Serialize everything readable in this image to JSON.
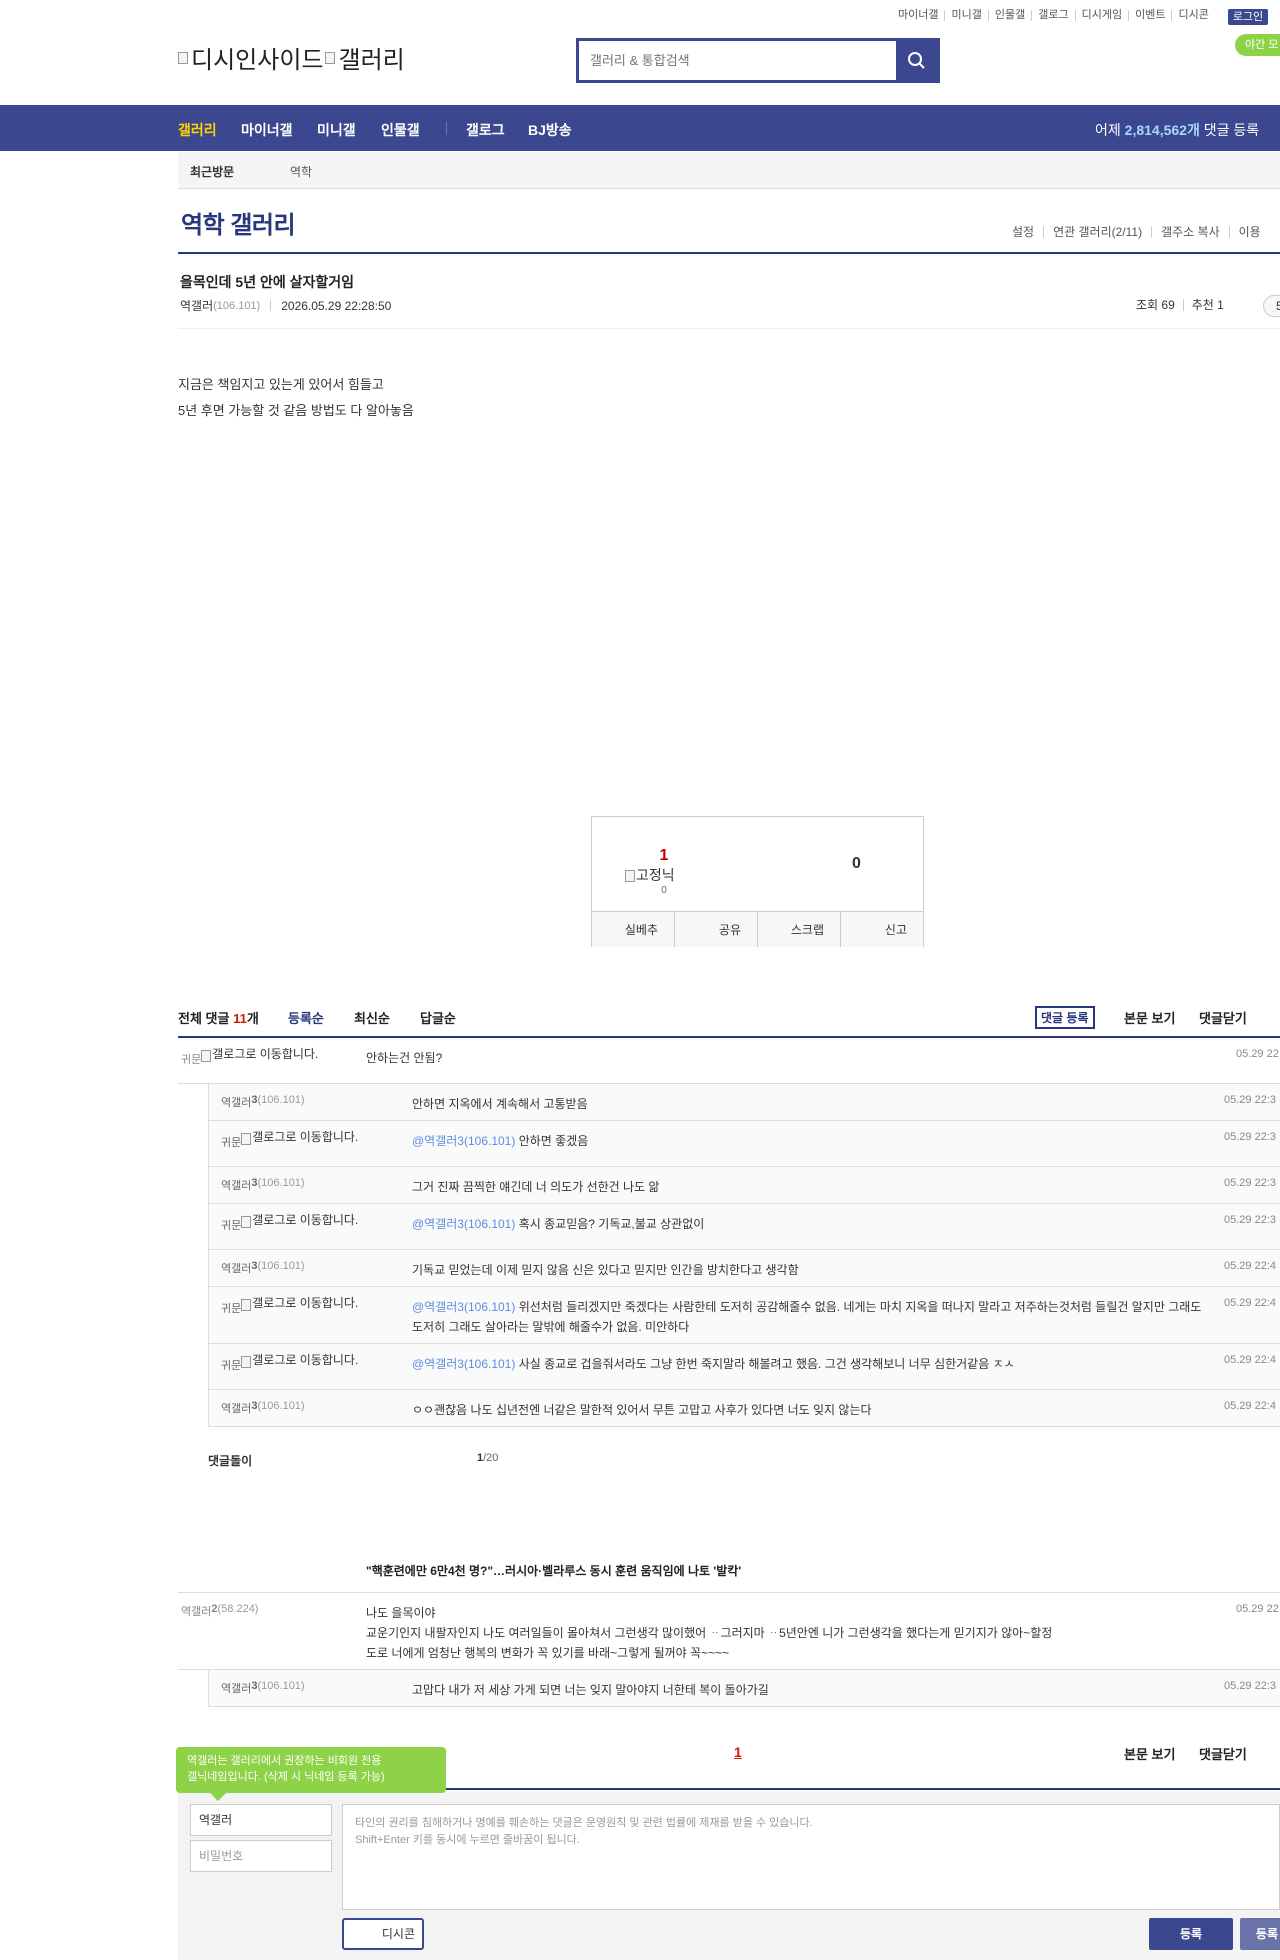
{
  "top_links": [
    "마이너갤",
    "미니갤",
    "인물갤",
    "갤로그",
    "디시게임",
    "이벤트",
    "디시콘"
  ],
  "login_label": "로그인",
  "night_label": "야간 모",
  "logo": {
    "alt_main": "디시인사이드",
    "alt_sub": "갤러리"
  },
  "search": {
    "placeholder": "갤러리 & 통합검색"
  },
  "gnb": {
    "items": [
      "갤러리",
      "마이너갤",
      "미니갤",
      "인물갤",
      "갤로그",
      "BJ방송"
    ],
    "count_prefix": "어제 ",
    "count_value": "2,814,562개",
    "count_suffix": " 댓글 등록"
  },
  "recent_visit": {
    "label": "최근방문",
    "item": "역학"
  },
  "gallery": {
    "title": "역학 갤러리",
    "links": [
      "설정",
      "연관 갤러리(2/11)",
      "갤주소 복사",
      "이용"
    ]
  },
  "post": {
    "title": "을목인데 5년 안에 살자할거임",
    "author": "역갤러",
    "ip": "(106.101)",
    "datetime": "2026.05.29 22:28:50",
    "views_label": "조회 69",
    "recommend_label": "추천 1",
    "pill": "5",
    "content": [
      "지금은 책임지고 있는게 있어서 힘들고",
      "5년 후면 가능할 것 같음 방법도 다 알아놓음"
    ]
  },
  "recommend": {
    "up": "1",
    "gonick_alt": "고정닉",
    "gonick_count": "0",
    "down": "0",
    "buttons": [
      "실베추",
      "공유",
      "스크랩",
      "신고"
    ]
  },
  "comments_header": {
    "total_label": "전체 댓글 ",
    "total_count": "11",
    "total_suffix": "개",
    "sorts": [
      "등록순",
      "최신순",
      "답글순"
    ],
    "register": "댓글 등록",
    "view_post": "본문 보기",
    "close": "댓글닫기"
  },
  "comments": [
    {
      "nick_prefix": "귀문",
      "img_alt": "갤로그로 이동합니다.",
      "text": "안하는건 안됨?",
      "date": "05.29 22"
    },
    {
      "reply": true,
      "nick": "역갤러",
      "num": "3",
      "ip": "(106.101)",
      "text": "안하면 지옥에서 계속해서 고통받음",
      "date": "05.29 22:3"
    },
    {
      "reply": true,
      "nick_prefix": "귀문",
      "img_alt": "갤로그로 이동합니다.",
      "mention": "@역갤러3(106.101)",
      "text": " 안하면 좋겠음",
      "date": "05.29 22:3"
    },
    {
      "reply": true,
      "nick": "역갤러",
      "num": "3",
      "ip": "(106.101)",
      "text": "그거 진짜 끔찍한 얘긴데 너 의도가 선한건 나도 앎",
      "date": "05.29 22:3"
    },
    {
      "reply": true,
      "nick_prefix": "귀문",
      "img_alt": "갤로그로 이동합니다.",
      "mention": "@역갤러3(106.101)",
      "text": " 혹시 종교믿음? 기독교,불교 상관없이",
      "date": "05.29 22:3"
    },
    {
      "reply": true,
      "nick": "역갤러",
      "num": "3",
      "ip": "(106.101)",
      "text": "기독교 믿었는데 이제 믿지 않음 신은 있다고 믿지만 인간을 방치한다고 생각함",
      "date": "05.29 22:4"
    },
    {
      "reply": true,
      "nick_prefix": "귀문",
      "img_alt": "갤로그로 이동합니다.",
      "mention": "@역갤러3(106.101)",
      "text": " 위선처럼 들리겠지만 죽겠다는 사람한테 도저히 공감해줄수 없음. 네게는 마치 지옥을 떠나지 말라고 저주하는것처럼 들릴건 알지만 그래도 도저히 그래도 살아라는 말밖에 해줄수가 없음. 미안하다",
      "date": "05.29 22:4"
    },
    {
      "reply": true,
      "nick_prefix": "귀문",
      "img_alt": "갤로그로 이동합니다.",
      "mention": "@역갤러3(106.101)",
      "text": " 사실 종교로 겁을줘서라도 그냥 한번 죽지말라 해볼려고 했음. 그건 생각해보니 너무 심한거같음 ㅈㅅ",
      "date": "05.29 22:4"
    },
    {
      "reply": true,
      "nick": "역갤러",
      "num": "3",
      "ip": "(106.101)",
      "text": "ㅇㅇ괜찮음 나도 십년전엔 너같은 말한적 있어서 무튼 고맙고 사후가 있다면 너도 잊지 않는다",
      "date": "05.29 22:4"
    }
  ],
  "dcbot": {
    "label": "댓글돌이",
    "page_current": "1",
    "page_total": "/20"
  },
  "news_title": "\"핵훈련에만 6만4천 명?\"…러시아·벨라루스 동시 훈련 움직임에 나토 '발칵'",
  "comment2": {
    "nick": "역갤러",
    "num": "2",
    "ip": "(58.224)",
    "lines": [
      "나도 을목이야",
      "교운기인지 내팔자인지 나도 여러일들이 몰아쳐서 그런생각 많이했어 ᆢ그러지마 ᆢ5년안엔 니가 그런생각을 했다는게 믿기지가 않아~할정",
      "도로 너에게 엄청난 행복의 변화가 꼭 있기를 바래~그렇게 될꺼야 꼭~~~~"
    ],
    "date": "05.29 22"
  },
  "reply2": {
    "nick": "역갤러",
    "num": "3",
    "ip": "(106.101)",
    "text": "고맙다 내가 저 세상 가게 되면 너는 잊지 말아야지 너한테 복이 돌아가길",
    "date": "05.29 22:3"
  },
  "footer": {
    "page": "1",
    "view_post": "본문 보기",
    "close": "댓글닫기"
  },
  "tooltip": [
    "역갤러는 갤러리에서 권장하는 비회원 전용",
    "갤닉네임입니다. (삭제 시 닉네임 등록 가능)"
  ],
  "write": {
    "nick": "역갤러",
    "password_placeholder": "비밀번호",
    "notice": [
      "타인의 권리를 침해하거나 명예를 훼손하는 댓글은 운영원칙 및 관련 법률에 제재를 받을 수 있습니다.",
      "Shift+Enter 키를 동시에 누르면 줄바꿈이 됩니다."
    ],
    "dccon": "디시콘",
    "submit": "등록",
    "submit2": "등록"
  }
}
